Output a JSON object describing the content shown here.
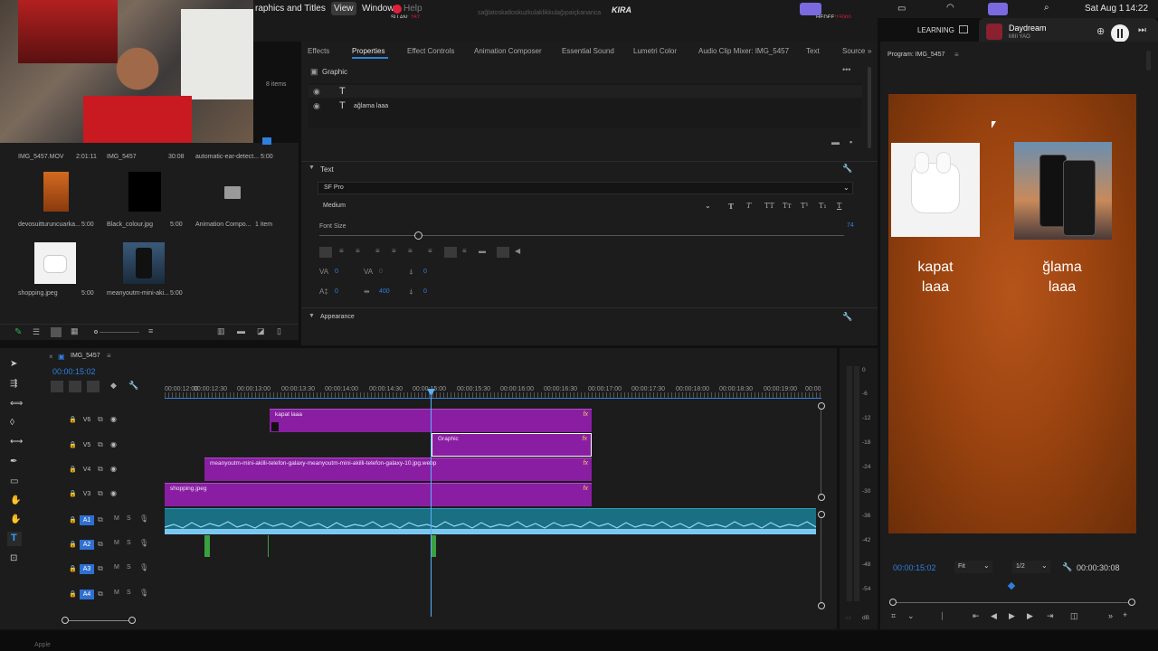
{
  "menubar": {
    "app_menu": "raphics and Titles",
    "view": "View",
    "window": "Window",
    "help": "Help",
    "kira": "KIRA",
    "su_an": "ŞU AN:",
    "su_an_val": "287",
    "hedef": "HEDEF:",
    "hedef_val": "15000",
    "marquee": "sağlatoskatloskuzkulaklikkulağıpaiçkanarica",
    "date": "Sat Aug 1",
    "time": "14:22",
    "learning": "LEARNING"
  },
  "now_playing": {
    "title": "Daydream",
    "artist": "MIII YAO"
  },
  "project": {
    "item_count": "8 items",
    "clips": [
      {
        "name": "IMG_5457.MOV",
        "dur": "2:01:11"
      },
      {
        "name": "IMG_5457",
        "dur": "30:08"
      },
      {
        "name": "automatic-ear-detect...",
        "dur": "5:00"
      },
      {
        "name": "devosuitturuncuarka...",
        "dur": "5:00"
      },
      {
        "name": "Black_colour.jpg",
        "dur": "5:00"
      },
      {
        "name": "Animation Compo...",
        "dur": "1 item"
      },
      {
        "name": "shopping.jpeg",
        "dur": "5:00"
      },
      {
        "name": "meanyoutm-mini-aki...",
        "dur": "5:00"
      }
    ]
  },
  "tabs": [
    "Effects",
    "Properties",
    "Effect Controls",
    "Animation Composer",
    "Essential Sound",
    "Lumetri Color",
    "Audio Clip Mixer: IMG_5457",
    "Text",
    "Source"
  ],
  "properties": {
    "section": "Graphic",
    "layer1": "",
    "layer2": "ağlama laaa",
    "text_section": "Text",
    "font": "SF Pro",
    "weight": "Medium",
    "font_size_label": "Font Size",
    "font_size": "74",
    "tracking": "0",
    "kerning": "0",
    "baseline": "0",
    "leading": "0",
    "line_spacing": "400",
    "tsume": "0",
    "appearance": "Appearance"
  },
  "program": {
    "title": "Program: IMG_5457",
    "left_text_1": "kapat",
    "left_text_2": "laaa",
    "right_text_1": "ğlama",
    "right_text_2": "laaa",
    "timecode": "00:00:15:02",
    "fit": "Fit",
    "resolution": "1/2",
    "duration": "00:00:30:08"
  },
  "timeline": {
    "sequence": "IMG_5457",
    "timecode": "00:00:15:02",
    "ruler": [
      "00:00:12:00",
      "00:00:12:30",
      "00:00:13:00",
      "00:00:13:30",
      "00:00:14:00",
      "00:00:14:30",
      "00:00:15:00",
      "00:00:15:30",
      "00:00:16:00",
      "00:00:16:30",
      "00:00:17:00",
      "00:00:17:30",
      "00:00:18:00",
      "00:00:18:30",
      "00:00:19:00",
      "00:00"
    ],
    "tracks": [
      "V6",
      "V5",
      "V4",
      "V3",
      "A1",
      "A2",
      "A3",
      "A4"
    ],
    "clips": {
      "v6": "kapat laaa",
      "v5": "Graphic",
      "v4": "meanyoutm-mini-akilli-telefon-galaxy-meanyoutm-mini-akilli-telefon-galaxy-10.jpg.webp",
      "v3": "shopping.jpeg"
    },
    "fx": "fx",
    "meter_labels": [
      "0",
      "-6",
      "-12",
      "-18",
      "-24",
      "-30",
      "-36",
      "-42",
      "-48",
      "-54"
    ],
    "meter_bottom": "dB"
  },
  "taskbar": {
    "app": "Apple"
  },
  "colors": {
    "accent": "#2f7fe0",
    "clip": "#8a1ea3",
    "audio": "#1f8fa6",
    "playhead": "#5ab0ff"
  }
}
